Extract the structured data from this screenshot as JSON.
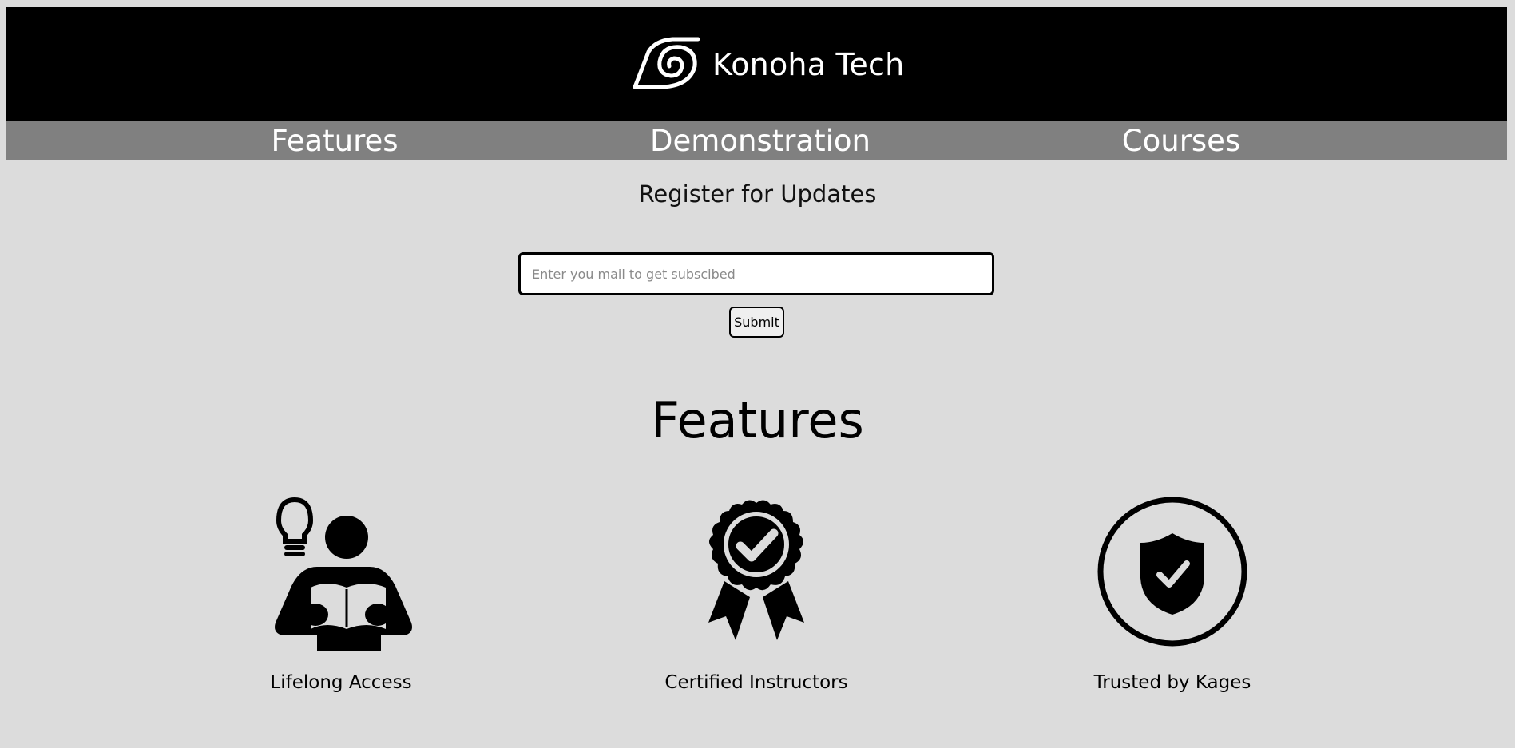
{
  "header": {
    "brand_name": "Konoha Tech",
    "logo_icon": "leaf-swirl-logo"
  },
  "nav": {
    "items": [
      {
        "label": "Features"
      },
      {
        "label": "Demonstration"
      },
      {
        "label": "Courses"
      }
    ]
  },
  "register": {
    "title": "Register for Updates",
    "email_placeholder": "Enter you mail to get subscibed",
    "email_value": "",
    "submit_label": "Submit"
  },
  "features": {
    "heading": "Features",
    "items": [
      {
        "label": "Lifelong Access",
        "icon": "reader-lightbulb-icon"
      },
      {
        "label": "Certified Instructors",
        "icon": "certified-badge-icon"
      },
      {
        "label": "Trusted by Kages",
        "icon": "shield-check-icon"
      }
    ]
  },
  "colors": {
    "header_bg": "#000000",
    "nav_bg": "#808080",
    "page_bg": "#dcdcdc"
  }
}
